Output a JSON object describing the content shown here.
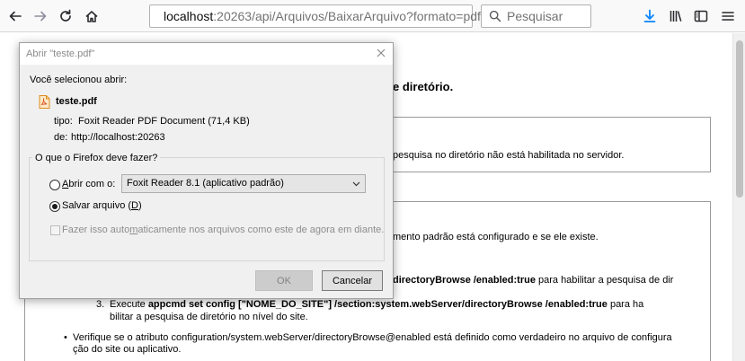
{
  "toolbar": {
    "url_host": "localhost",
    "url_rest": ":20263/api/Arquivos/BaixarArquivo?formato=pdf",
    "search_placeholder": "Pesquisar"
  },
  "page": {
    "error_title": "e diretório.",
    "box1_text": "pesquisa no diretório não está habilitada no servidor.",
    "line_default_doc": "mento padrão está configurado e se ele existe.",
    "line2_bold": "directoryBrowse /enabled:true",
    "line2_rest": " para habilitar a pesquisa de dir",
    "step3_num": "3.",
    "step3_prefix": "Execute ",
    "step3_bold": "appcmd set config [\"NOME_DO_SITE\"] /section:system.webServer/directoryBrowse /enabled:true",
    "step3_suffix": " para ha",
    "step3_line2": "bilitar a pesquisa de diretório no nível do site.",
    "bullet_line1": "Verifique se o atributo configuration/system.webServer/directoryBrowse@enabled está definido como verdadeiro no arquivo de configura",
    "bullet_line2": "ção do site ou aplicativo."
  },
  "dialog": {
    "title": "Abrir \"teste.pdf\"",
    "selected_label": "Você selecionou abrir:",
    "file_name": "teste.pdf",
    "type_label": "tipo:",
    "type_value": "Foxit Reader PDF Document (71,4 KB)",
    "from_label": "de:",
    "from_value": "http://localhost:20263",
    "group_label": "O que o Firefox deve fazer?",
    "open_with_label_pre": "",
    "open_with_underline": "A",
    "open_with_label_post": "brir com o:",
    "open_with_value": "Foxit Reader 8.1 (aplicativo padrão)",
    "save_label_pre": "Salvar arquivo (",
    "save_underline": "D",
    "save_label_post": ")",
    "auto_label_pre": "Fazer isso auto",
    "auto_underline": "m",
    "auto_label_post": "aticamente nos arquivos como este de agora em diante.",
    "ok_label": "OK",
    "cancel_label": "Cancelar"
  },
  "colors": {
    "toolbar_bg": "#f9f9fa",
    "download_icon": "#0a84ff",
    "dialog_bg": "#f0f0f0"
  }
}
